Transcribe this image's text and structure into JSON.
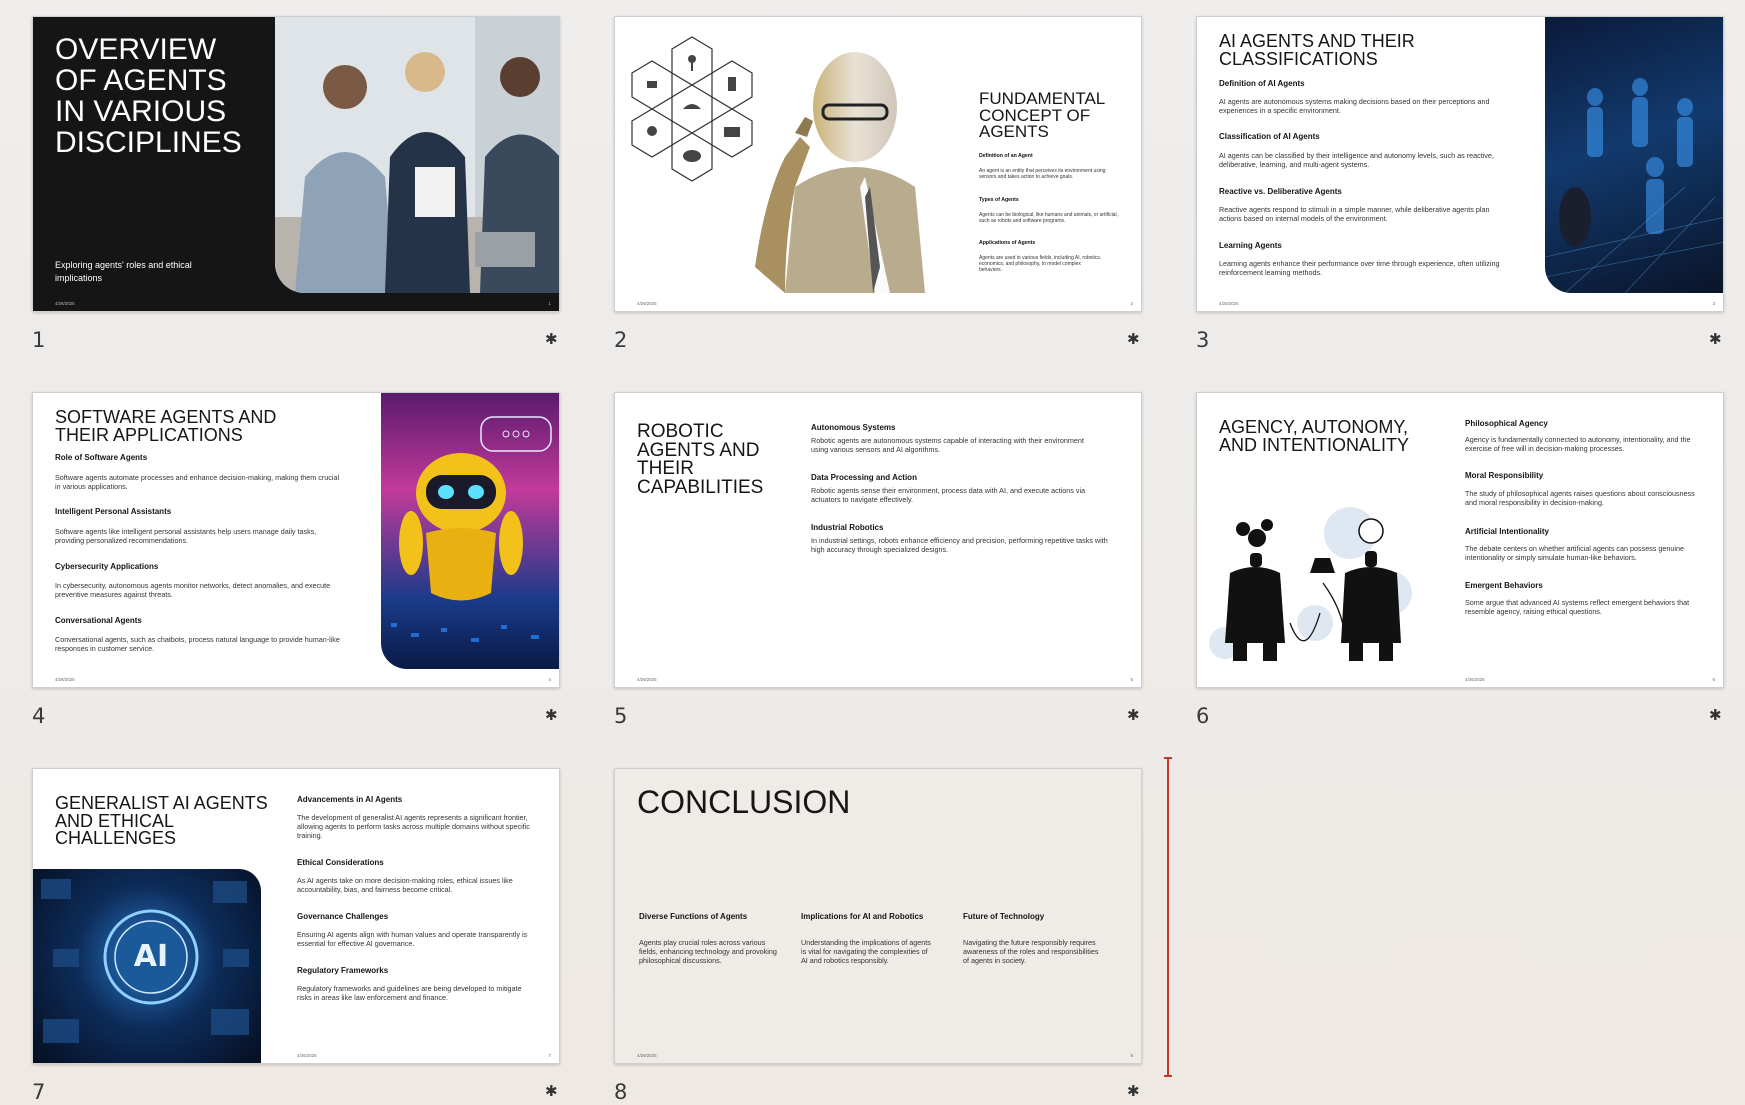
{
  "slides": [
    {
      "number": "1",
      "title": "OVERVIEW OF AGENTS IN VARIOUS DISCIPLINES",
      "subtitle": "Exploring agents' roles and ethical implications",
      "date": "4/26/2025",
      "page": "1"
    },
    {
      "number": "2",
      "title": "FUNDAMENTAL CONCEPT OF AGENTS",
      "date": "4/26/2025",
      "page": "2",
      "sections": [
        {
          "h": "Definition of an Agent",
          "b": "An agent is an entity that perceives its environment using sensors and takes action to achieve goals."
        },
        {
          "h": "Types of Agents",
          "b": "Agents can be biological, like humans and animals, or artificial, such as robots and software programs."
        },
        {
          "h": "Applications of Agents",
          "b": "Agents are used in various fields, including AI, robotics, economics, and philosophy, to model complex behaviors."
        }
      ]
    },
    {
      "number": "3",
      "title": "AI AGENTS AND THEIR CLASSIFICATIONS",
      "date": "4/26/2025",
      "page": "3",
      "sections": [
        {
          "h": "Definition of AI Agents",
          "b": "AI agents are autonomous systems making decisions based on their perceptions and experiences in a specific environment."
        },
        {
          "h": "Classification of AI Agents",
          "b": "AI agents can be classified by their intelligence and autonomy levels, such as reactive, deliberative, learning, and multi-agent systems."
        },
        {
          "h": "Reactive vs. Deliberative Agents",
          "b": "Reactive agents respond to stimuli in a simple manner, while deliberative agents plan actions based on internal models of the environment."
        },
        {
          "h": "Learning Agents",
          "b": "Learning agents enhance their performance over time through experience, often utilizing reinforcement learning methods."
        }
      ]
    },
    {
      "number": "4",
      "title": "SOFTWARE AGENTS AND THEIR APPLICATIONS",
      "date": "4/26/2025",
      "page": "4",
      "sections": [
        {
          "h": "Role of Software Agents",
          "b": "Software agents automate processes and enhance decision-making, making them crucial in various applications."
        },
        {
          "h": "Intelligent Personal Assistants",
          "b": "Software agents like intelligent personal assistants help users manage daily tasks, providing personalized recommendations."
        },
        {
          "h": "Cybersecurity Applications",
          "b": "In cybersecurity, autonomous agents monitor networks, detect anomalies, and execute preventive measures against threats."
        },
        {
          "h": "Conversational Agents",
          "b": "Conversational agents, such as chatbots, process natural language to provide human-like responses in customer service."
        }
      ]
    },
    {
      "number": "5",
      "title": "ROBOTIC AGENTS AND THEIR CAPABILITIES",
      "date": "4/26/2025",
      "page": "5",
      "sections": [
        {
          "h": "Autonomous Systems",
          "b": "Robotic agents are autonomous systems capable of interacting with their environment using various sensors and AI algorithms."
        },
        {
          "h": "Data Processing and Action",
          "b": "Robotic agents sense their environment, process data with AI, and execute actions via actuators to navigate effectively."
        },
        {
          "h": "Industrial Robotics",
          "b": "In industrial settings, robots enhance efficiency and precision, performing repetitive tasks with high accuracy through specialized designs."
        }
      ]
    },
    {
      "number": "6",
      "title": "AGENCY, AUTONOMY, AND INTENTIONALITY",
      "date": "4/26/2025",
      "page": "6",
      "sections": [
        {
          "h": "Philosophical Agency",
          "b": "Agency is fundamentally connected to autonomy, intentionality, and the exercise of free will in decision-making processes."
        },
        {
          "h": "Moral Responsibility",
          "b": "The study of philosophical agents raises questions about consciousness and moral responsibility in decision-making."
        },
        {
          "h": "Artificial Intentionality",
          "b": "The debate centers on whether artificial agents can possess genuine intentionality or simply simulate human-like behaviors."
        },
        {
          "h": "Emergent Behaviors",
          "b": "Some argue that advanced AI systems reflect emergent behaviors that resemble agency, raising ethical questions."
        }
      ]
    },
    {
      "number": "7",
      "title": "GENERALIST AI AGENTS AND ETHICAL CHALLENGES",
      "date": "4/26/2025",
      "page": "7",
      "image_text": "AI",
      "sections": [
        {
          "h": "Advancements in AI Agents",
          "b": "The development of generalist AI agents represents a significant frontier, allowing agents to perform tasks across multiple domains without specific training."
        },
        {
          "h": "Ethical Considerations",
          "b": "As AI agents take on more decision-making roles, ethical issues like accountability, bias, and fairness become critical."
        },
        {
          "h": "Governance Challenges",
          "b": "Ensuring AI agents align with human values and operate transparently is essential for effective AI governance."
        },
        {
          "h": "Regulatory Frameworks",
          "b": "Regulatory frameworks and guidelines are being developed to mitigate risks in areas like law enforcement and finance."
        }
      ]
    },
    {
      "number": "8",
      "title": "CONCLUSION",
      "date": "4/26/2025",
      "page": "8",
      "sections": [
        {
          "h": "Diverse Functions of Agents",
          "b": "Agents play crucial roles across various fields, enhancing technology and provoking philosophical discussions."
        },
        {
          "h": "Implications for AI and Robotics",
          "b": "Understanding the implications of agents is vital for navigating the complexities of AI and robotics responsibly."
        },
        {
          "h": "Future of Technology",
          "b": "Navigating the future responsibly requires awareness of the roles and responsibilities of agents in society."
        }
      ]
    }
  ],
  "star_glyph": "✱",
  "colors": {
    "accent_red": "#c0392b",
    "slide1_bg": "#151515",
    "slide8_bg": "#efebe6"
  }
}
